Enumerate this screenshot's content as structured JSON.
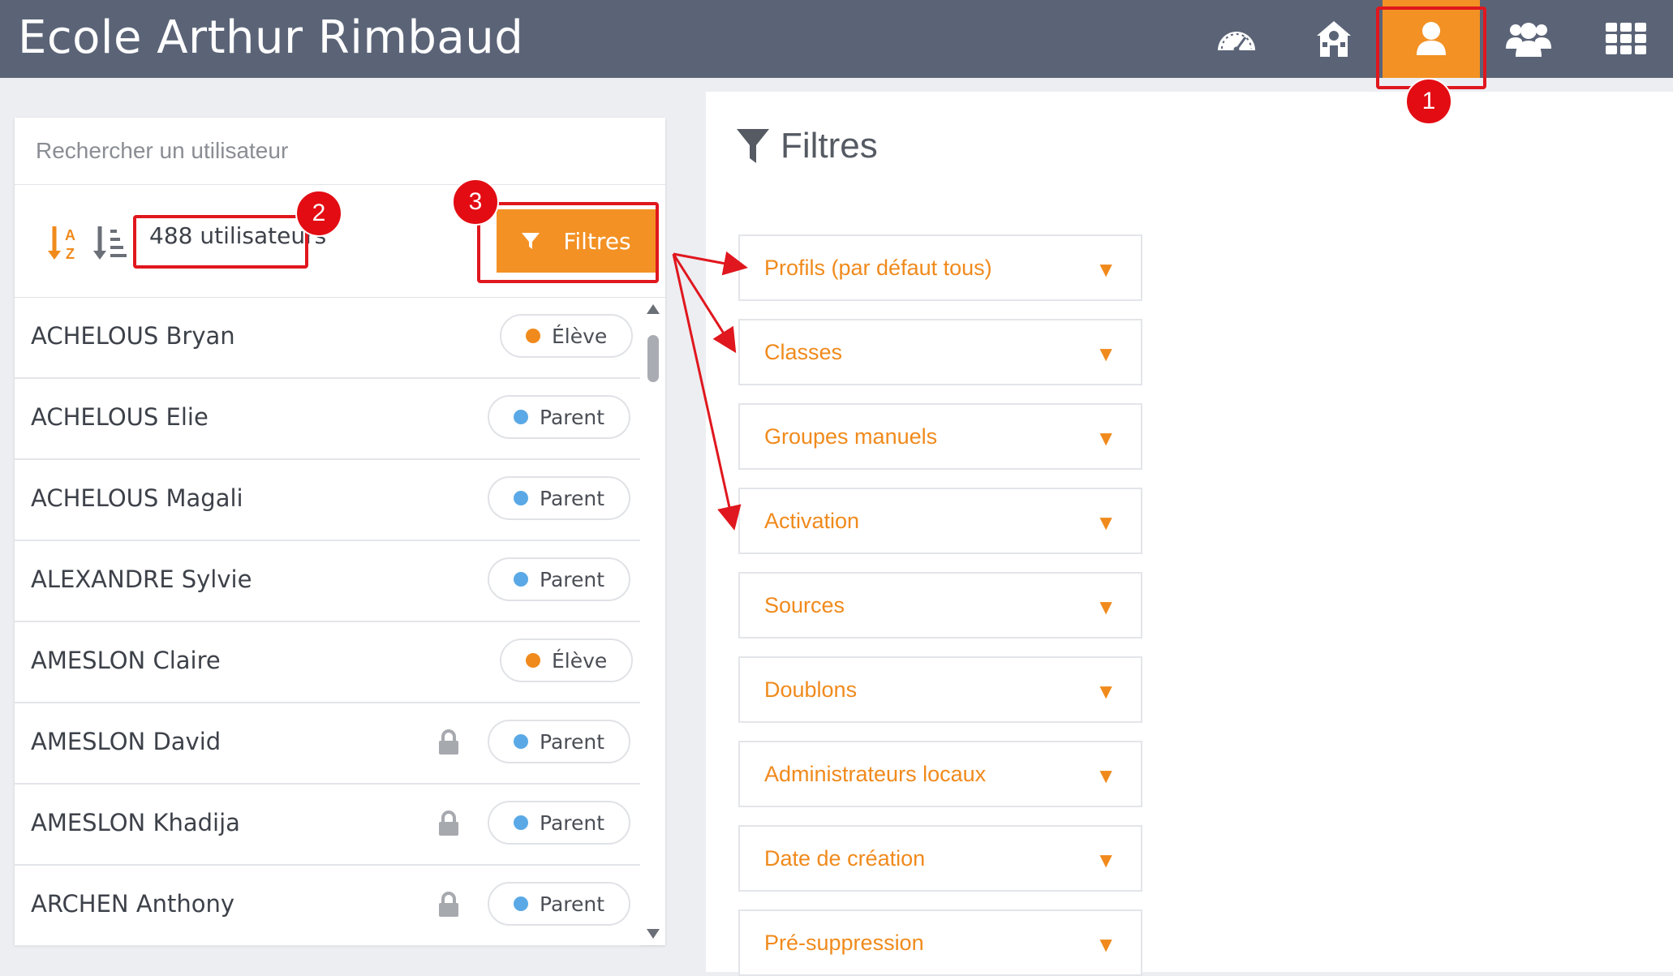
{
  "header": {
    "title": "Ecole Arthur Rimbaud",
    "nav": [
      {
        "icon": "dashboard-icon"
      },
      {
        "icon": "school-icon"
      },
      {
        "icon": "user-icon",
        "active": true
      },
      {
        "icon": "group-icon"
      },
      {
        "icon": "apps-grid-icon"
      }
    ]
  },
  "search": {
    "placeholder": "Rechercher un utilisateur",
    "value": ""
  },
  "toolbar": {
    "sort_alpha_icon": "sort-alpha-icon",
    "sort_list_icon": "sort-list-icon",
    "count": "488 utilisateurs",
    "filter_button": "Filtres"
  },
  "users": [
    {
      "name": "ACHELOUS Bryan",
      "profile": "Élève",
      "locked": false
    },
    {
      "name": "ACHELOUS Elie",
      "profile": "Parent",
      "locked": false
    },
    {
      "name": "ACHELOUS Magali",
      "profile": "Parent",
      "locked": false
    },
    {
      "name": "ALEXANDRE Sylvie",
      "profile": "Parent",
      "locked": false
    },
    {
      "name": "AMESLON Claire",
      "profile": "Élève",
      "locked": false
    },
    {
      "name": "AMESLON David",
      "profile": "Parent",
      "locked": true
    },
    {
      "name": "AMESLON Khadija",
      "profile": "Parent",
      "locked": true
    },
    {
      "name": "ARCHEN Anthony",
      "profile": "Parent",
      "locked": true
    }
  ],
  "profile_colors": {
    "Élève": "#f08a1c",
    "Parent": "#5aa9e6"
  },
  "filters_panel": {
    "title": "Filtres",
    "items": [
      "Profils (par défaut tous)",
      "Classes",
      "Groupes manuels",
      "Activation",
      "Sources",
      "Doublons",
      "Administrateurs locaux",
      "Date de création",
      "Pré-suppression"
    ]
  },
  "annotations": [
    "1",
    "2",
    "3"
  ],
  "colors": {
    "accent": "#f39124",
    "header": "#5b6477",
    "annotation": "#e0171e"
  }
}
